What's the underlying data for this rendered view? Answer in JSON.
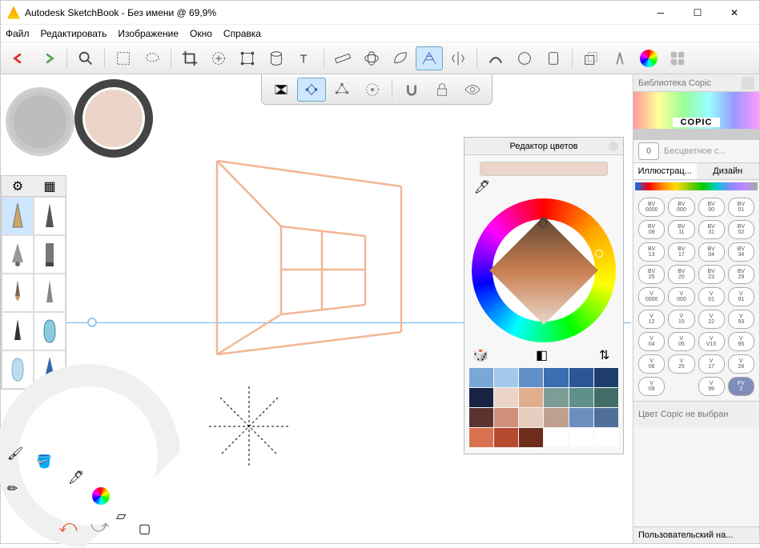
{
  "window": {
    "title": "Autodesk SketchBook - Без имени @ 69,9%"
  },
  "menu": {
    "file": "Файл",
    "edit": "Редактировать",
    "image": "Изображение",
    "window": "Окно",
    "help": "Справка"
  },
  "toolbar": {
    "undo": "undo",
    "redo": "redo",
    "zoom": "zoom",
    "marquee": "marquee",
    "lasso": "lasso",
    "crop": "crop",
    "addframe": "addframe",
    "quadtrans": "quad",
    "cylinder": "cylinder",
    "text": "text",
    "ruler": "ruler",
    "ellipse": "ellipse",
    "french": "french",
    "perspective": "perspective",
    "symmetry": "symmetry",
    "stroke": "stroke",
    "shape": "shape",
    "fill": "fill",
    "layers": "layers",
    "brush": "brush",
    "color": "color",
    "ui": "ui"
  },
  "subtoolbar": {
    "mode1": "1pt",
    "mode2": "2pt",
    "mode3": "3pt",
    "mode4": "fisheye",
    "snap": "snap",
    "lock": "lock",
    "vis": "visible"
  },
  "coloreditor": {
    "title": "Редактор цветов",
    "current_hex": "#ECD5C8",
    "swatches": [
      "#7aa7d9",
      "#a5c8ec",
      "#5f90c9",
      "#396fb1",
      "#2b5696",
      "#1d3d6e",
      "#172342",
      "#ecd5c8",
      "#e1ad8f",
      "#7d9e96",
      "#5e8f8a",
      "#426e68",
      "#5b3430",
      "#d08f7b",
      "#e8cdbf",
      "#bfa08e",
      "#6a8fbf",
      "#4f6f99",
      "#d8714f",
      "#b54a2f",
      "#6e2d1b",
      "#ffffff",
      "#ffffff",
      "#ffffff"
    ]
  },
  "copic": {
    "title": "Библиотека Copic",
    "brand": "COPIC",
    "none_label": "Бесцветное с...",
    "none_zero": "0",
    "tab_illustration": "Иллюстрац...",
    "tab_design": "Дизайн",
    "msg": "Цвет Copic не выбран",
    "footer": "Пользовательский на...",
    "chips": [
      {
        "t": "BV",
        "b": "0000"
      },
      {
        "t": "BV",
        "b": "000"
      },
      {
        "t": "BV",
        "b": "00"
      },
      {
        "t": "BV",
        "b": "01"
      },
      {
        "t": "BV",
        "b": "08"
      },
      {
        "t": "BV",
        "b": "11"
      },
      {
        "t": "BV",
        "b": "31"
      },
      {
        "t": "BV",
        "b": "02"
      },
      {
        "t": "BV",
        "b": "13"
      },
      {
        "t": "BV",
        "b": "17"
      },
      {
        "t": "BV",
        "b": "04"
      },
      {
        "t": "BV",
        "b": "34"
      },
      {
        "t": "BV",
        "b": "25"
      },
      {
        "t": "BV",
        "b": "20"
      },
      {
        "t": "BV",
        "b": "23"
      },
      {
        "t": "BV",
        "b": "29"
      },
      {
        "t": "V",
        "b": "0000"
      },
      {
        "t": "V",
        "b": "000"
      },
      {
        "t": "V",
        "b": "01"
      },
      {
        "t": "V",
        "b": "91"
      },
      {
        "t": "V",
        "b": "12"
      },
      {
        "t": "V",
        "b": "15"
      },
      {
        "t": "V",
        "b": "22"
      },
      {
        "t": "V",
        "b": "93"
      },
      {
        "t": "V",
        "b": "04"
      },
      {
        "t": "V",
        "b": "05"
      },
      {
        "t": "V",
        "b": "V15"
      },
      {
        "t": "V",
        "b": "95"
      },
      {
        "t": "V",
        "b": "06"
      },
      {
        "t": "V",
        "b": "25"
      },
      {
        "t": "V",
        "b": "17"
      },
      {
        "t": "V",
        "b": "28"
      },
      {
        "t": "V",
        "b": "09"
      },
      {
        "t": "",
        "b": ""
      },
      {
        "t": "V",
        "b": "99"
      },
      {
        "t": "FV",
        "b": "2",
        "on": true
      }
    ]
  },
  "brushes": {
    "cells": [
      "pencil",
      "pen",
      "airbrush",
      "marker",
      "paintbrush",
      "smudge",
      "ink",
      "eraser-hard",
      "eraser-soft",
      "chisel"
    ]
  }
}
